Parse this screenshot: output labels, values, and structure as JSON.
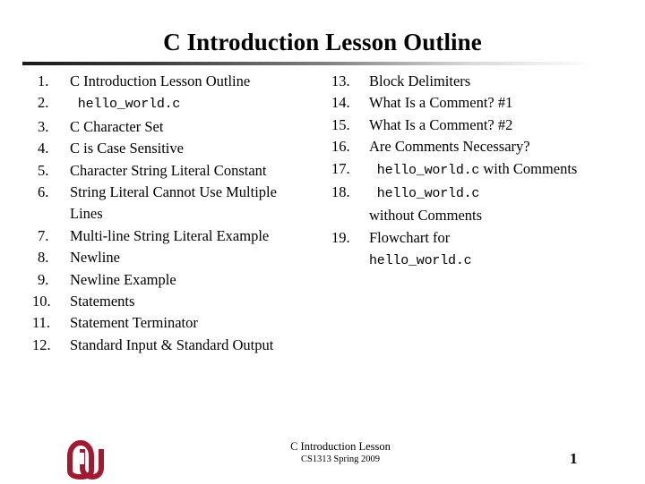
{
  "slide": {
    "title": "C Introduction Lesson Outline",
    "page_number": "1"
  },
  "outline": {
    "left_column": [
      {
        "number": "1.",
        "text": "C Introduction Lesson Outline",
        "mono": false
      },
      {
        "number": "2.",
        "text": " hello_world.c",
        "mono": true
      },
      {
        "number": "3.",
        "text": "C Character Set",
        "mono": false
      },
      {
        "number": "4.",
        "text": "C is Case Sensitive",
        "mono": false
      },
      {
        "number": "5.",
        "text": "Character String Literal Constant",
        "mono": false
      },
      {
        "number": "6.",
        "text": "String Literal Cannot Use Multiple Lines",
        "mono": false
      },
      {
        "number": "7.",
        "text": "Multi-line String Literal Example",
        "mono": false
      },
      {
        "number": "8.",
        "text": "Newline",
        "mono": false
      },
      {
        "number": "9.",
        "text": "Newline Example",
        "mono": false
      },
      {
        "number": "10.",
        "text": "Statements",
        "mono": false
      },
      {
        "number": "11.",
        "text": "Statement Terminator",
        "mono": false
      },
      {
        "number": "12.",
        "text": "Standard Input & Standard Output",
        "mono": false
      }
    ],
    "right_column": [
      {
        "number": "13.",
        "text": "Block Delimiters",
        "mono": false
      },
      {
        "number": "14.",
        "text": "What Is a Comment? #1",
        "mono": false
      },
      {
        "number": "15.",
        "text": "What Is a Comment? #2",
        "mono": false
      },
      {
        "number": "16.",
        "text": "Are Comments Necessary?",
        "mono": false
      },
      {
        "number": "17.",
        "mono_prefix": " hello_world.c",
        "text": " with Comments",
        "mono": "mixed"
      },
      {
        "number": "18.",
        "mono_prefix": " hello_world.c",
        "text": "",
        "text_line2": "without Comments",
        "mono": "mixed"
      },
      {
        "number": "19.",
        "text": "Flowchart for",
        "mono_suffix": "hello_world.c",
        "mono": "suffix"
      }
    ]
  },
  "logo": {
    "name": "ou-logo",
    "alt": "OU",
    "color": "#9e1b32"
  },
  "footer": {
    "line1": "C Introduction Lesson",
    "line2": "CS1313 Spring 2009"
  }
}
